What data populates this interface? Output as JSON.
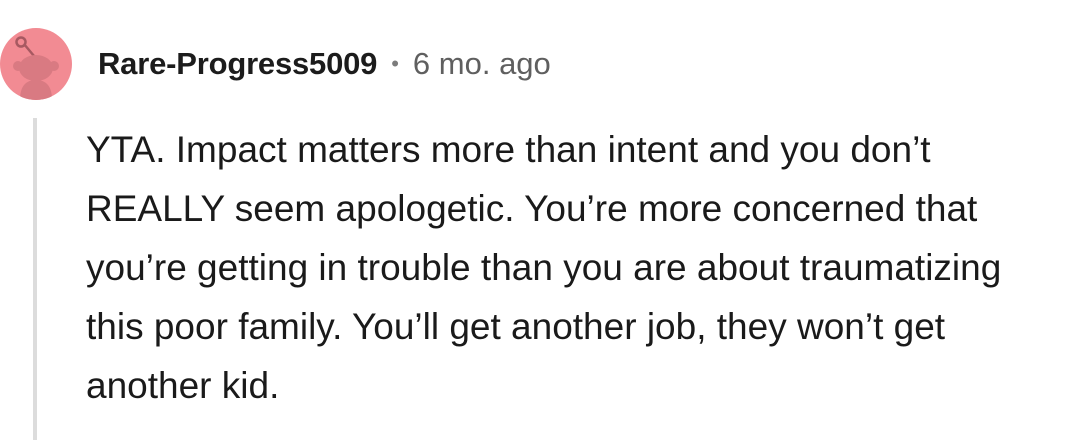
{
  "comment": {
    "author": "Rare-Progress5009",
    "separator": "•",
    "timestamp": "6 mo. ago",
    "body": "YTA. Impact matters more than intent and you don’t REALLY seem apologetic. You’re more concerned that you’re getting in trouble than you are about traumatizing this poor family. You’ll get another job, they won’t get another kid."
  },
  "avatar": {
    "icon": "snoo-avatar-icon",
    "background_color": "#f28b93",
    "figure_color": "#d97a82"
  }
}
